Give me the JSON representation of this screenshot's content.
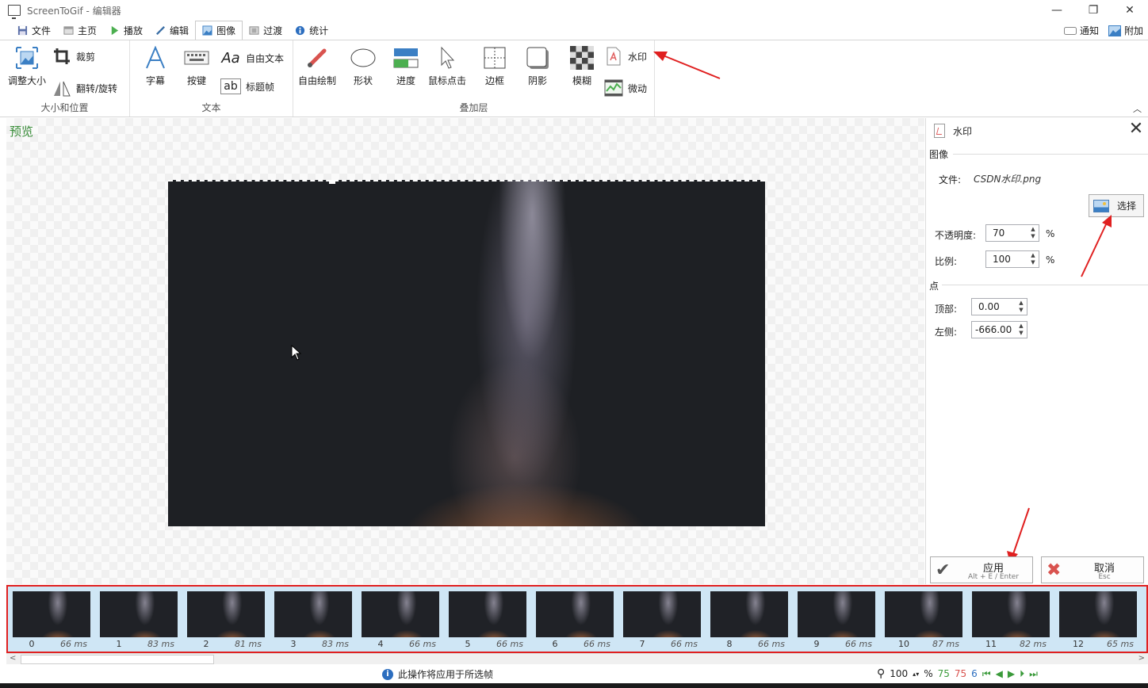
{
  "window": {
    "title": "ScreenToGif - 编辑器",
    "minimize": "—",
    "restore": "❐",
    "close": "✕"
  },
  "tabs": [
    {
      "label": "文件",
      "icon": "save-icon"
    },
    {
      "label": "主页",
      "icon": "home-icon"
    },
    {
      "label": "播放",
      "icon": "play-icon"
    },
    {
      "label": "编辑",
      "icon": "pencil-icon"
    },
    {
      "label": "图像",
      "icon": "image-icon",
      "active": true
    },
    {
      "label": "过渡",
      "icon": "transition-icon"
    },
    {
      "label": "统计",
      "icon": "info-icon"
    }
  ],
  "tabs_right": {
    "notify": "通知",
    "addon": "附加"
  },
  "ribbon": {
    "size_group": {
      "label": "大小和位置",
      "resize": "调整大小",
      "crop": "裁剪",
      "flip": "翻转/旋转"
    },
    "text_group": {
      "label": "文本",
      "caption": "字幕",
      "keys": "按键",
      "freetext": "自由文本",
      "titleframe": "标题帧",
      "freetext_glyph": "Aa",
      "titleframe_glyph": "ab"
    },
    "overlay_group": {
      "label": "叠加层",
      "freedraw": "自由绘制",
      "shape": "形状",
      "progress": "进度",
      "mouseclick": "鼠标点击",
      "border": "边框",
      "shadow": "阴影",
      "blur": "模糊",
      "watermark": "水印",
      "cinemagraph": "微动"
    }
  },
  "preview": {
    "label": "预览"
  },
  "panel": {
    "title": "水印",
    "image_section": "图像",
    "file_label": "文件:",
    "file_value": "CSDN水印.png",
    "choose": "选择",
    "opacity_label": "不透明度:",
    "opacity_value": "70",
    "scale_label": "比例:",
    "scale_value": "100",
    "percent": "%",
    "point_section": "点",
    "top_label": "顶部:",
    "top_value": "0.00",
    "left_label": "左侧:",
    "left_value": "-666.00",
    "apply": "应用",
    "apply_shortcut": "Alt + E / Enter",
    "cancel": "取消",
    "cancel_shortcut": "Esc"
  },
  "frames": [
    {
      "index": "0",
      "delay": "66 ms"
    },
    {
      "index": "1",
      "delay": "83 ms"
    },
    {
      "index": "2",
      "delay": "81 ms"
    },
    {
      "index": "3",
      "delay": "83 ms"
    },
    {
      "index": "4",
      "delay": "66 ms"
    },
    {
      "index": "5",
      "delay": "66 ms"
    },
    {
      "index": "6",
      "delay": "66 ms"
    },
    {
      "index": "7",
      "delay": "66 ms"
    },
    {
      "index": "8",
      "delay": "66 ms"
    },
    {
      "index": "9",
      "delay": "66 ms"
    },
    {
      "index": "10",
      "delay": "87 ms"
    },
    {
      "index": "11",
      "delay": "82 ms"
    },
    {
      "index": "12",
      "delay": "65 ms"
    }
  ],
  "status": {
    "message": "此操作将应用于所选帧",
    "zoom": "100",
    "zoom_unit": "%",
    "count_total": "75",
    "count_selected": "75",
    "count_other": "6"
  },
  "colors": {
    "accent_green": "#3a8e3a",
    "annotation_red": "#e02020",
    "strip_bg": "#cfe6f5"
  }
}
